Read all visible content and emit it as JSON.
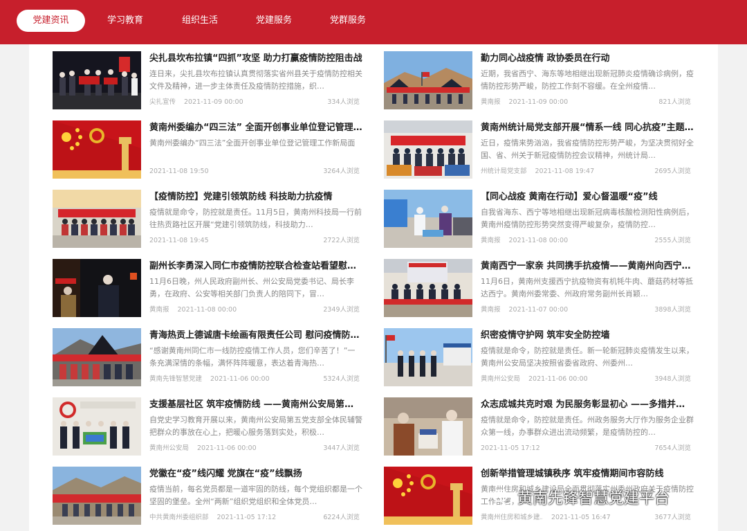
{
  "nav": {
    "tabs": [
      {
        "label": "党建资讯"
      },
      {
        "label": "学习教育"
      },
      {
        "label": "组织生活"
      },
      {
        "label": "党建服务"
      },
      {
        "label": "党群服务"
      }
    ]
  },
  "articles": [
    {
      "title": "尖扎县坎布拉镇“四抓”攻坚 助力打赢疫情防控阻击战",
      "summary": "连日来，尖扎县坎布拉镇认真贯彻落实省州县关于疫情防控相关文件及精神，进一步主体责任及疫情防控措施，织…",
      "source": "尖扎宣传",
      "date": "2021-11-09 00:00",
      "views": "334人浏览",
      "thumb": "night-group"
    },
    {
      "title": "勤力同心战疫情 政协委员在行动",
      "summary": "近期，我省西宁、海东等地相继出现新冠肺炎疫情确诊病例，疫情防控形势严峻，防控工作刻不容缓。在全州疫情…",
      "source": "黄南报",
      "date": "2021-11-09 00:00",
      "views": "821人浏览",
      "thumb": "tents"
    },
    {
      "title": "黄南州委编办“四三法” 全面开创事业单位登记管理工作新局面",
      "summary": "黄南州委编办“四三法”全面开创事业单位登记管理工作新局面",
      "source": "",
      "date": "2021-11-08 19:50",
      "views": "3264人浏览",
      "thumb": "party-flag"
    },
    {
      "title": "黄南州统计局党支部开展“情系一线 同心抗疫”主题党日活动",
      "summary": "近日，疫情来势汹汹，我省疫情防控形势严峻，为坚决贯彻好全国、省、州关于新冠疫情防控会议精神，州统计局…",
      "source": "州统计局党支部",
      "date": "2021-11-08 19:47",
      "views": "2695人浏览",
      "thumb": "supplies"
    },
    {
      "title": "【疫情防控】党建引领筑防线 科技助力抗疫情",
      "summary": "疫情就是命令，防控就是责任。11月5日，黄南州科技局一行前往热贡路社区开展“党建引领筑防线，科技助力…",
      "source": "",
      "date": "2021-11-08 19:45",
      "views": "2722人浏览",
      "thumb": "banner-group"
    },
    {
      "title": "【同心战疫 黄南在行动】爱心督温暖“疫”线",
      "summary": "自我省海东、西宁等地相继出现新冠病毒核酸检测阳性病例后，黄南州疫情防控形势突然变得严峻复杂，疫情防控…",
      "source": "黄南报",
      "date": "2021-11-08 00:00",
      "views": "2555人浏览",
      "thumb": "checkpoint"
    },
    {
      "title": "副州长李勇深入同仁市疫情防控联合检查站看望慰问一线工作人员",
      "summary": "11月6日晚，州人民政府副州长、州公安局党委书记、局长李勇，在政府、公安等相关部门负责人的陪同下，冒…",
      "source": "黄南报",
      "date": "2021-11-08 00:00",
      "views": "2349人浏览",
      "thumb": "night-visit"
    },
    {
      "title": "黄南西宁一家亲 共同携手抗疫情——黄南州向西宁市捐赠抗疫物资",
      "summary": "11月6日，黄南州支援西宁抗疫物资有机牦牛肉、蘑菇药材等抵达西宁。黄南州委常委、州政府常务副州长肖颖…",
      "source": "黄南报",
      "date": "2021-11-07 00:00",
      "views": "3898人浏览",
      "thumb": "donation"
    },
    {
      "title": "青海热贡上德诚唐卡绘画有限责任公司 慰问疫情防控一线工作人员",
      "summary": "“感谢黄南州同仁市一线防控疫情工作人员，您们辛苦了！”一条充满深情的条幅，满怀阵阵暖意，表达着青海热…",
      "source": "黄南先锋智慧党建",
      "date": "2021-11-06 00:00",
      "views": "5324人浏览",
      "thumb": "hill-group"
    },
    {
      "title": "织密疫情守护网 筑牢安全防控墙",
      "summary": "疫情就是命令，防控就是责任。新一轮新冠肺炎疫情发生以来，黄南州公安局坚决按照省委省政府、州委州…",
      "source": "黄南州公安局",
      "date": "2021-11-06 00:00",
      "views": "3948人浏览",
      "thumb": "police"
    },
    {
      "title": "支援基层社区 筑牢疫情防线 ——黄南州公安局第五党支部开展主题党日活动",
      "summary": "自党史学习教育开展以来，黄南州公安局第五党支部全体民辅警把群众的事放在心上，把暖心服务落到实处，积极…",
      "source": "黄南州公安局",
      "date": "2021-11-06 00:00",
      "views": "3447人浏览",
      "thumb": "indoor-group"
    },
    {
      "title": "众志成城共克时艰 为民服务彰显初心 ——多措并举做好疫情防控工作",
      "summary": "疫情就是命令，防控就是责任。州政务服务大厅作为服务企业群众第一线，办事群众进出流动频繁，是疫情防控的…",
      "source": "",
      "date": "2021-11-05 17:12",
      "views": "7654人浏览",
      "thumb": "service-hall"
    },
    {
      "title": "党徽在“疫”线闪耀 党旗在“疫”线飘扬",
      "summary": "疫情当前，每名党员都是一道牢固的防线，每个党组织都是一个坚固的堡垒。全州“两新”组织党组织和全体党员…",
      "source": "中共黄南州委组织部",
      "date": "2021-11-05 17:12",
      "views": "6224人浏览",
      "thumb": "hill-banner"
    },
    {
      "title": "创新举措管理城镇秩序 筑牢疫情期间市容防线",
      "summary": "黄南州住房和城乡建设局全面贯彻落实州委州政府关于疫情防控工作部署，…",
      "source": "黄南州住房和城乡建…",
      "date": "2021-11-05 16:47",
      "views": "3677人浏览",
      "thumb": "party-flag"
    }
  ],
  "watermark": {
    "text": "黄南先锋智慧党建平台",
    "icon": "wechat-icon"
  },
  "colors": {
    "brand_red": "#c71f2c",
    "title": "#222222",
    "summary": "#888888",
    "meta": "#aaaaaa"
  }
}
